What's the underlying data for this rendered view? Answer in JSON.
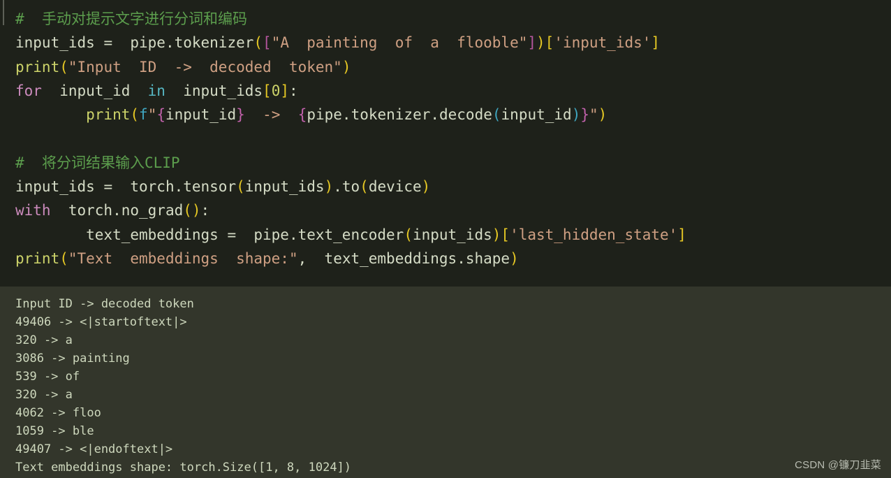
{
  "window": {
    "title": "Jupyter code cell — CLIP tokenization",
    "code_background": "#1e211a",
    "output_background": "#33362b"
  },
  "colors": {
    "comment": "#5c9e4d",
    "keyword": "#cc8bbd",
    "keyword_in": "#56b6c2",
    "function": "#cdd46a",
    "identifier": "#d5dcc6",
    "string": "#cfa083",
    "paren_yellow": "#e6c824",
    "bracket_magenta": "#b5569e",
    "paren_cyan": "#3fa6c0",
    "output_text": "#ced8bd",
    "watermark": "#b9bdb2"
  },
  "code": {
    "language": "python",
    "lines": [
      {
        "index": 1,
        "text": "# 手动对提示文字进行分词和编码",
        "tokens": [
          {
            "t": "# ",
            "c": "t-com"
          },
          {
            "t": " 手动对提示文字进行分词和编码",
            "c": "t-com"
          }
        ]
      },
      {
        "index": 2,
        "text": "input_ids = pipe.tokenizer([\"A painting of a flooble\"])['input_ids']",
        "tokens": [
          {
            "t": "input_ids ",
            "c": "t-id"
          },
          {
            "t": "= ",
            "c": "t-op"
          },
          {
            "t": " pipe.tokenizer",
            "c": "t-id"
          },
          {
            "t": "(",
            "c": "t-par-y"
          },
          {
            "t": "[",
            "c": "t-par-m"
          },
          {
            "t": "\"A  painting  of  a  flooble\"",
            "c": "t-str"
          },
          {
            "t": "]",
            "c": "t-par-m"
          },
          {
            "t": ")",
            "c": "t-par-y"
          },
          {
            "t": "[",
            "c": "t-par-y"
          },
          {
            "t": "'input_ids'",
            "c": "t-str"
          },
          {
            "t": "]",
            "c": "t-par-y"
          }
        ]
      },
      {
        "index": 3,
        "text": "print(\"Input ID -> decoded token\")",
        "tokens": [
          {
            "t": "print",
            "c": "t-fn"
          },
          {
            "t": "(",
            "c": "t-par-y"
          },
          {
            "t": "\"Input  ID  ->  decoded  token\"",
            "c": "t-str"
          },
          {
            "t": ")",
            "c": "t-par-y"
          }
        ]
      },
      {
        "index": 4,
        "text": "for input_id in input_ids[0]:",
        "tokens": [
          {
            "t": "for",
            "c": "t-kw"
          },
          {
            "t": "  input_id ",
            "c": "t-id"
          },
          {
            "t": " in",
            "c": "t-kw2"
          },
          {
            "t": "  input_ids",
            "c": "t-id"
          },
          {
            "t": "[",
            "c": "t-par-y"
          },
          {
            "t": "0",
            "c": "t-num"
          },
          {
            "t": "]",
            "c": "t-par-y"
          },
          {
            "t": ":",
            "c": "t-id"
          }
        ]
      },
      {
        "index": 5,
        "text": "        print(f\"{input_id} -> {pipe.tokenizer.decode(input_id)}\")",
        "tokens": [
          {
            "t": "        print",
            "c": "t-fn"
          },
          {
            "t": "(",
            "c": "t-par-y"
          },
          {
            "t": "f",
            "c": "t-fpre"
          },
          {
            "t": "\"",
            "c": "t-str"
          },
          {
            "t": "{",
            "c": "t-brace-m"
          },
          {
            "t": "input_id",
            "c": "t-id"
          },
          {
            "t": "}",
            "c": "t-brace-m"
          },
          {
            "t": "  ",
            "c": "t-id"
          },
          {
            "t": "->",
            "c": "t-str"
          },
          {
            "t": "  ",
            "c": "t-id"
          },
          {
            "t": "{",
            "c": "t-brace-m"
          },
          {
            "t": "pipe.tokenizer.decode",
            "c": "t-id"
          },
          {
            "t": "(",
            "c": "t-par-c"
          },
          {
            "t": "input_id",
            "c": "t-id"
          },
          {
            "t": ")",
            "c": "t-par-c"
          },
          {
            "t": "}",
            "c": "t-brace-m"
          },
          {
            "t": "\"",
            "c": "t-str"
          },
          {
            "t": ")",
            "c": "t-par-y"
          }
        ]
      },
      {
        "index": 6,
        "text": "",
        "tokens": []
      },
      {
        "index": 7,
        "text": "# 将分词结果输入CLIP",
        "tokens": [
          {
            "t": "# ",
            "c": "t-com"
          },
          {
            "t": " 将分词结果输入CLIP",
            "c": "t-com"
          }
        ]
      },
      {
        "index": 8,
        "text": "input_ids = torch.tensor(input_ids).to(device)",
        "tokens": [
          {
            "t": "input_ids ",
            "c": "t-id"
          },
          {
            "t": "= ",
            "c": "t-op"
          },
          {
            "t": " torch.tensor",
            "c": "t-id"
          },
          {
            "t": "(",
            "c": "t-par-y"
          },
          {
            "t": "input_ids",
            "c": "t-id"
          },
          {
            "t": ")",
            "c": "t-par-y"
          },
          {
            "t": ".to",
            "c": "t-id"
          },
          {
            "t": "(",
            "c": "t-par-y"
          },
          {
            "t": "device",
            "c": "t-id"
          },
          {
            "t": ")",
            "c": "t-par-y"
          }
        ]
      },
      {
        "index": 9,
        "text": "with torch.no_grad():",
        "tokens": [
          {
            "t": "with",
            "c": "t-kw"
          },
          {
            "t": "  torch.no_grad",
            "c": "t-id"
          },
          {
            "t": "(",
            "c": "t-par-y"
          },
          {
            "t": ")",
            "c": "t-par-y"
          },
          {
            "t": ":",
            "c": "t-id"
          }
        ]
      },
      {
        "index": 10,
        "text": "        text_embeddings = pipe.text_encoder(input_ids)['last_hidden_state']",
        "tokens": [
          {
            "t": "        text_embeddings ",
            "c": "t-id"
          },
          {
            "t": "= ",
            "c": "t-op"
          },
          {
            "t": " pipe.text_encoder",
            "c": "t-id"
          },
          {
            "t": "(",
            "c": "t-par-y"
          },
          {
            "t": "input_ids",
            "c": "t-id"
          },
          {
            "t": ")",
            "c": "t-par-y"
          },
          {
            "t": "[",
            "c": "t-par-y"
          },
          {
            "t": "'last_hidden_state'",
            "c": "t-str"
          },
          {
            "t": "]",
            "c": "t-par-y"
          }
        ]
      },
      {
        "index": 11,
        "text": "print(\"Text embeddings shape:\", text_embeddings.shape)",
        "tokens": [
          {
            "t": "print",
            "c": "t-fn"
          },
          {
            "t": "(",
            "c": "t-par-y"
          },
          {
            "t": "\"Text  embeddings  shape:\"",
            "c": "t-str"
          },
          {
            "t": ",",
            "c": "t-id"
          },
          {
            "t": "  text_embeddings.shape",
            "c": "t-id"
          },
          {
            "t": ")",
            "c": "t-par-y"
          }
        ]
      }
    ]
  },
  "output": {
    "header": "Input ID -> decoded token",
    "rows": [
      {
        "id": "49406",
        "arrow": "->",
        "token": "<|startoftext|>",
        "line": "49406 -> <|startoftext|>"
      },
      {
        "id": "320",
        "arrow": "->",
        "token": "a",
        "line": "320 -> a"
      },
      {
        "id": "3086",
        "arrow": "->",
        "token": "painting",
        "line": "3086 -> painting"
      },
      {
        "id": "539",
        "arrow": "->",
        "token": "of",
        "line": "539 -> of"
      },
      {
        "id": "320",
        "arrow": "->",
        "token": "a",
        "line": "320 -> a"
      },
      {
        "id": "4062",
        "arrow": "->",
        "token": "floo",
        "line": "4062 -> floo"
      },
      {
        "id": "1059",
        "arrow": "->",
        "token": "ble",
        "line": "1059 -> ble"
      },
      {
        "id": "49407",
        "arrow": "->",
        "token": "<|endoftext|>",
        "line": "49407 -> <|endoftext|>"
      }
    ],
    "footer": "Text embeddings shape: torch.Size([1, 8, 1024])"
  },
  "watermark": {
    "text": "CSDN @镰刀韭菜"
  }
}
